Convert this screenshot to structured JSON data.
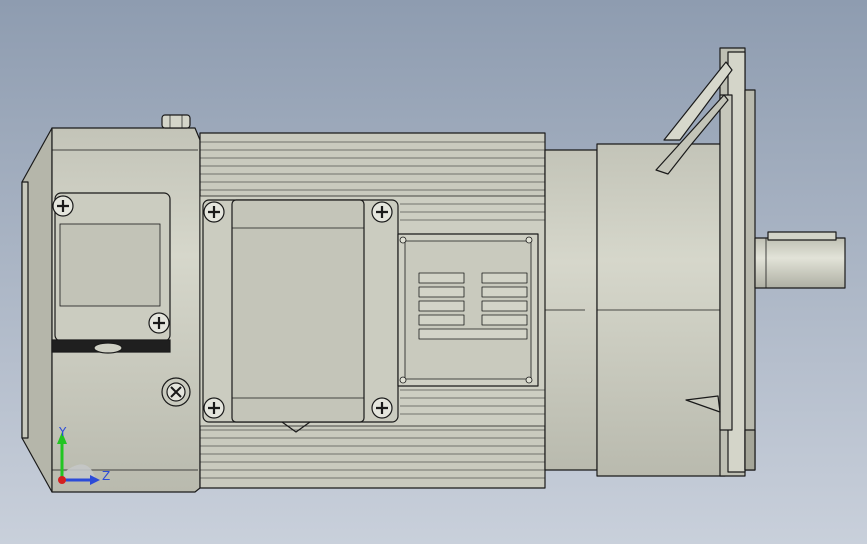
{
  "viewport": {
    "background_top": "#8e9cb0",
    "background_bottom": "#c9d0db"
  },
  "model": {
    "body_color": "#cfd0c4",
    "body_shadow": "#a9aa9e",
    "edge_color": "#1a1a1a",
    "screw_color": "#e8e8e0"
  },
  "triad": {
    "y_label": "Y",
    "z_label": "Z",
    "y_color": "#22c522",
    "z_color": "#2c4bd8",
    "x_color": "#d42020"
  }
}
